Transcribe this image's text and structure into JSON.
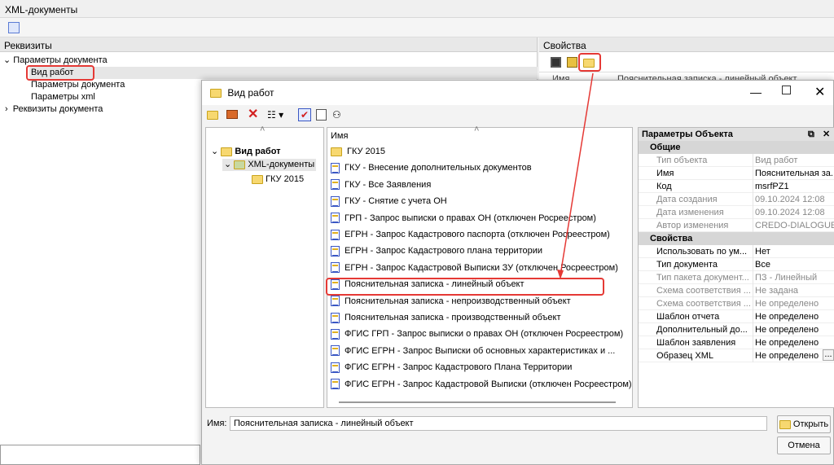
{
  "window_title": "XML-документы",
  "left_panel": {
    "header": "Реквизиты",
    "tree": [
      {
        "label": "Параметры документа"
      },
      {
        "label": "Вид работ"
      },
      {
        "label": "Параметры документа"
      },
      {
        "label": "Параметры xml"
      },
      {
        "label": "Реквизиты документа"
      }
    ]
  },
  "right_panel": {
    "header": "Свойства",
    "col_name": "Имя",
    "col_value": "Пояснительная записка - линейный объект"
  },
  "dialog": {
    "title": "Вид работ",
    "tree": [
      {
        "label": "Вид работ"
      },
      {
        "label": "XML-документы"
      },
      {
        "label": "ГКУ 2015"
      }
    ],
    "list_header": "Имя",
    "items": [
      {
        "label": "ГКУ 2015",
        "icon": "folder"
      },
      {
        "label": "ГКУ - Внесение дополнительных документов",
        "icon": "doc"
      },
      {
        "label": "ГКУ - Все Заявления",
        "icon": "doc"
      },
      {
        "label": "ГКУ - Снятие с учета ОН",
        "icon": "doc"
      },
      {
        "label": "ГРП - Запрос выписки о правах ОН (отключен Росреестром)",
        "icon": "doc"
      },
      {
        "label": "ЕГРН - Запрос Кадастрового паспорта (отключен Росреестром)",
        "icon": "doc"
      },
      {
        "label": "ЕГРН - Запрос Кадастрового плана территории",
        "icon": "doc"
      },
      {
        "label": "ЕГРН - Запрос Кадастровой Выписки ЗУ (отключен Росреестром)",
        "icon": "doc"
      },
      {
        "label": "Пояснительная записка - линейный объект",
        "icon": "doc"
      },
      {
        "label": "Пояснительная записка - непроизводственный объект",
        "icon": "doc"
      },
      {
        "label": "Пояснительная записка - производственный объект",
        "icon": "doc"
      },
      {
        "label": "ФГИС ГРП - Запрос выписки о правах ОН (отключен Росреестром)",
        "icon": "doc"
      },
      {
        "label": "ФГИС ЕГРН - Запрос Выписки об основных характеристиках и ...",
        "icon": "doc"
      },
      {
        "label": "ФГИС ЕГРН - Запрос Кадастрового Плана Территории",
        "icon": "doc"
      },
      {
        "label": "ФГИС ЕГРН - Запрос Кадастровой Выписки (отключен Росреестром)",
        "icon": "doc"
      }
    ],
    "props": {
      "title": "Параметры Объекта",
      "group1": "Общие",
      "rows1": [
        {
          "name": "Тип объекта",
          "value": "Вид работ",
          "ro": true
        },
        {
          "name": "Имя",
          "value": "Пояснительная за...",
          "ro": false
        },
        {
          "name": "Код",
          "value": "msrfPZ1",
          "ro": false
        },
        {
          "name": "Дата создания",
          "value": "09.10.2024 12:08",
          "ro": true
        },
        {
          "name": "Дата изменения",
          "value": "09.10.2024 12:08",
          "ro": true
        },
        {
          "name": "Автор изменения",
          "value": "CREDO-DIALOGUE",
          "ro": true
        }
      ],
      "group2": "Свойства",
      "rows2": [
        {
          "name": "Использовать по ум...",
          "value": "Нет",
          "ro": false
        },
        {
          "name": "Тип документа",
          "value": "Все",
          "ro": false
        },
        {
          "name": "Тип пакета документ...",
          "value": "ПЗ - Линейный",
          "ro": true
        },
        {
          "name": "Схема соответствия ...",
          "value": "Не задана",
          "ro": true
        },
        {
          "name": "Схема соответствия ...",
          "value": "Не определено",
          "ro": true
        },
        {
          "name": "Шаблон отчета",
          "value": "Не определено",
          "ro": false
        },
        {
          "name": "Дополнительный до...",
          "value": "Не определено",
          "ro": false
        },
        {
          "name": "Шаблон заявления",
          "value": "Не определено",
          "ro": false
        },
        {
          "name": "Образец XML",
          "value": "Не определено",
          "ro": false
        }
      ],
      "ellipsis": "..."
    },
    "name_label": "Имя:",
    "name_value": "Пояснительная записка - линейный объект",
    "open_label": "Открыть",
    "cancel_label": "Отмена"
  },
  "colors": {
    "highlight": "#e53935"
  }
}
